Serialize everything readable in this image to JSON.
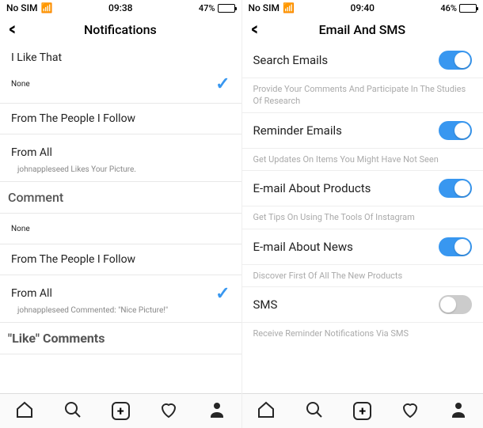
{
  "left": {
    "status": {
      "carrier": "No SIM",
      "time": "09:38",
      "battery": "47%",
      "battery_pct": 47
    },
    "header": {
      "title": "Notifications",
      "back": "<"
    },
    "items": {
      "like_that": "I Like That",
      "none1": "None",
      "from_follow1": "From The People I Follow",
      "from_all1": "From All",
      "example1": "johnappleseed Likes Your Picture.",
      "comment_section": "Comment",
      "none2": "None",
      "from_follow2": "From The People I Follow",
      "from_all2": "From All",
      "example2": "johnappleseed Commented: \"Nice Picture!\"",
      "like_comments": "\"Like\" Comments"
    }
  },
  "right": {
    "status": {
      "carrier": "No SIM",
      "time": "09:40",
      "battery": "46%",
      "battery_pct": 46
    },
    "header": {
      "title": "Email And SMS",
      "back": "<"
    },
    "items": {
      "search_emails": "Search Emails",
      "search_desc": "Provide Your Comments And Participate In The Studies Of Research",
      "reminder_emails": "Reminder Emails",
      "reminder_desc": "Get Updates On Items You Might Have Not Seen",
      "email_products": "E-mail About Products",
      "products_desc": "Get Tips On Using The Tools Of Instagram",
      "email_news": "E-mail About News",
      "news_desc": "Discover First Of All The New Products",
      "sms": "SMS",
      "sms_desc": "Receive Reminder Notifications Via SMS"
    },
    "toggles": {
      "search": true,
      "reminder": true,
      "products": true,
      "news": true,
      "sms": false
    }
  }
}
